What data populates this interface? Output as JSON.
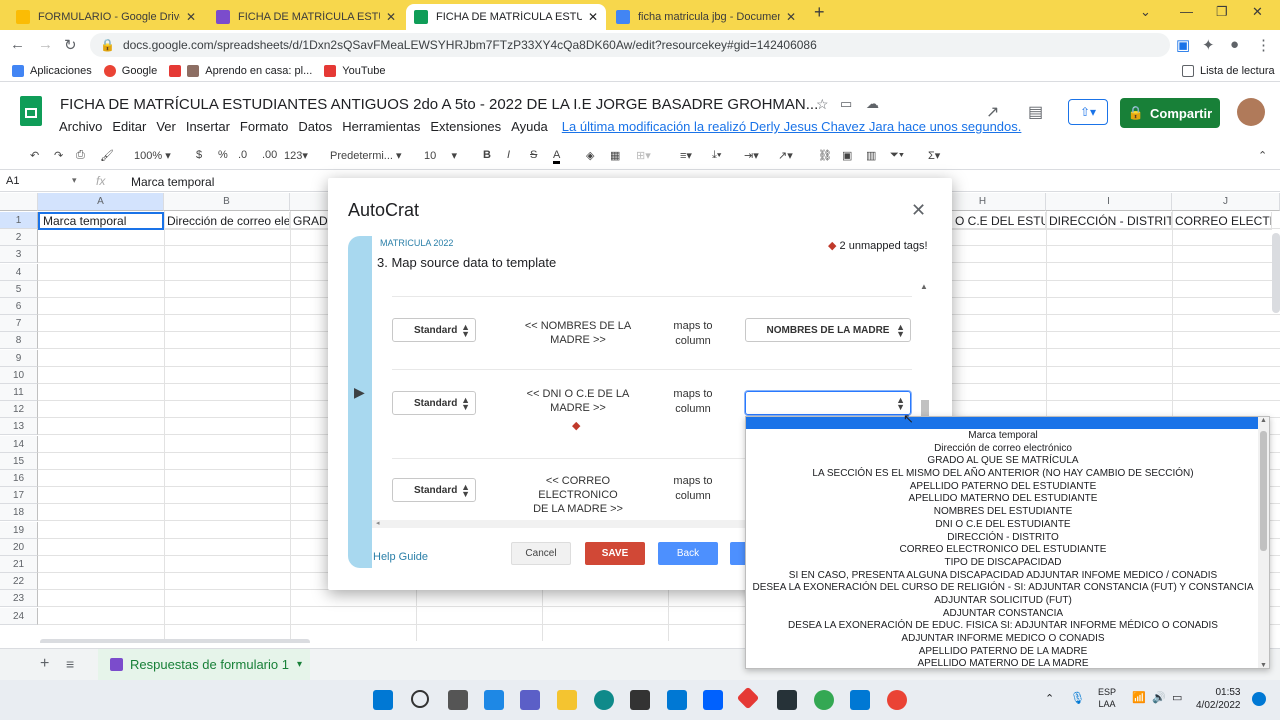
{
  "browser": {
    "tabs": [
      {
        "label": "FORMULARIO - Google Drive",
        "color": "#4285f4"
      },
      {
        "label": "FICHA DE MATRÍCULA ESTUDIAN",
        "color": "#7b4ccc"
      },
      {
        "label": "FICHA DE MATRÍCULA ESTUDIAN",
        "color": "#0f9d58"
      },
      {
        "label": "ficha matricula jbg - Documento",
        "color": "#4285f4"
      }
    ],
    "url": "docs.google.com/spreadsheets/d/1Dxn2sQSavFMeaLEWSYHRJbm7FTzP33XY4cQa8DK60Aw/edit?resourcekey#gid=142406086",
    "bookmarks": [
      "Aplicaciones",
      "Google",
      "Aprendo en casa: pl...",
      "YouTube"
    ],
    "reading_list": "Lista de lectura"
  },
  "doc": {
    "title": "FICHA DE MATRÍCULA  ESTUDIANTES ANTIGUOS 2do A 5to  - 2022  DE LA I.E JORGE BASADRE GROHMAN...",
    "menus": [
      "Archivo",
      "Editar",
      "Ver",
      "Insertar",
      "Formato",
      "Datos",
      "Herramientas",
      "Extensiones",
      "Ayuda"
    ],
    "last_edit": "La última modificación la realizó Derly Jesus Chavez Jara hace unos segundos.",
    "share": "Compartir"
  },
  "format_bar": {
    "zoom": "100%",
    "currency": "$",
    "percent": "%",
    "dec_less": ".0",
    "dec_more": ".00",
    "number_format": "123",
    "font": "Predetermi...",
    "size": "10",
    "bold": "B",
    "italic": "I",
    "strike": "S",
    "textcolor": "A"
  },
  "formula_bar": {
    "cell_ref": "A1",
    "fx": "fx",
    "content": "Marca temporal"
  },
  "grid": {
    "columns": [
      "A",
      "B",
      "C",
      "D",
      "E",
      "F",
      "G",
      "H",
      "I",
      "J"
    ],
    "rows": [
      "1",
      "2",
      "3",
      "4",
      "5",
      "6",
      "7",
      "8",
      "9",
      "10",
      "11",
      "12",
      "13",
      "14",
      "15",
      "16",
      "17",
      "18",
      "19",
      "20",
      "21",
      "22",
      "23",
      "24"
    ],
    "row1": {
      "A": "Marca temporal",
      "B": "Dirección de correo elect",
      "C": "GRADO",
      "H": "O C.E DEL ESTUDIA",
      "I": "DIRECCIÓN - DISTRITO",
      "J": "CORREO ELECTR"
    }
  },
  "sheet_tab": "Respuestas de formulario 1",
  "modal": {
    "title": "AutoCrat",
    "subtitle": "MATRICULA 2022",
    "step": "3. Map source data to template",
    "unmapped": "2 unmapped tags!",
    "rows": [
      {
        "type": "Standard",
        "tag": "<< NOMBRES DE LA MADRE >>",
        "maps_to": "maps to column",
        "column": "NOMBRES DE LA MADRE"
      },
      {
        "type": "Standard",
        "tag": "<< DNI O C.E DE LA MADRE >>",
        "maps_to": "maps to column",
        "column": ""
      },
      {
        "type": "Standard",
        "tag": "<< CORREO ELECTRONICO DE LA MADRE >>",
        "maps_to": "maps to column",
        "column": ""
      }
    ],
    "help": "Help Guide",
    "cancel": "Cancel",
    "save": "SAVE",
    "back": "Back"
  },
  "dropdown": {
    "options": [
      "Marca temporal",
      "Dirección de correo electrónico",
      "GRADO AL QUE SE MATRÍCULA",
      "LA SECCIÓN ES EL MISMO DEL AÑO ANTERIOR (NO HAY CAMBIO DE SECCIÓN)",
      "APELLIDO PATERNO DEL ESTUDIANTE",
      "APELLIDO MATERNO DEL ESTUDIANTE",
      "NOMBRES DEL ESTUDIANTE",
      "DNI O C.E DEL ESTUDIANTE",
      "DIRECCIÓN - DISTRITO",
      "CORREO ELECTRONICO DEL ESTUDIANTE",
      "TIPO DE DISCAPACIDAD",
      "SI EN CASO, PRESENTA ALGUNA DISCAPACIDAD ADJUNTAR INFOME MEDICO / CONADIS",
      "DESEA LA EXONERACIÓN DEL CURSO DE RELIGIÓN - SI: ADJUNTAR CONSTANCIA (FUT) Y CONSTANCIA",
      "ADJUNTAR SOLICITUD (FUT)",
      "ADJUNTAR CONSTANCIA",
      "DESEA LA EXONERACIÓN DE EDUC. FISICA SI: ADJUNTAR INFORME MÉDICO O CONADIS",
      "ADJUNTAR INFORME MEDICO O CONADIS",
      "APELLIDO PATERNO DE LA MADRE",
      "APELLIDO MATERNO DE LA MADRE"
    ]
  },
  "taskbar": {
    "lang": "ESP",
    "lang2": "LAA",
    "time": "01:53",
    "date": "4/02/2022"
  }
}
